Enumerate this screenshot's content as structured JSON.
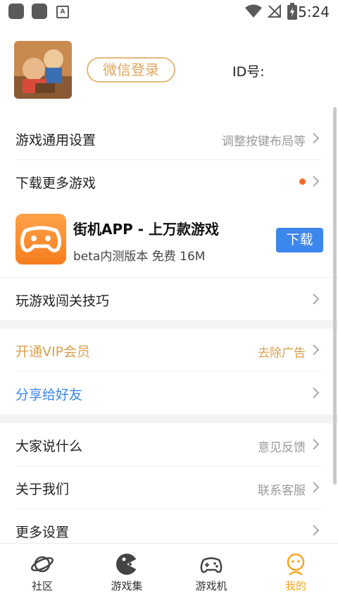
{
  "status_bar": {
    "time": "5:24",
    "badge_letter": "A"
  },
  "profile": {
    "login_button": "微信登录",
    "id_label": "ID号:"
  },
  "settings_rows": [
    {
      "label": "游戏通用设置",
      "hint": "调整按键布局等"
    },
    {
      "label": "下载更多游戏",
      "hint": ""
    }
  ],
  "app_promo": {
    "title": "街机APP - 上万款游戏",
    "subtitle": "beta内测版本 免费 16M",
    "download_label": "下载"
  },
  "tips_row": {
    "label": "玩游戏闯关技巧"
  },
  "vip_row": {
    "label": "开通VIP会员",
    "hint": "去除广告",
    "color": "#d9a04f"
  },
  "share_row": {
    "label": "分享给好友",
    "color": "#3b87ec"
  },
  "more_rows": [
    {
      "label": "大家说什么",
      "hint": "意见反馈"
    },
    {
      "label": "关于我们",
      "hint": "联系客服"
    },
    {
      "label": "更多设置",
      "hint": ""
    }
  ],
  "tabs": [
    {
      "label": "社区",
      "icon": "planet-icon",
      "active": false
    },
    {
      "label": "游戏集",
      "icon": "pacman-icon",
      "active": false
    },
    {
      "label": "游戏机",
      "icon": "gamepad-icon",
      "active": false
    },
    {
      "label": "我的",
      "icon": "profile-icon",
      "active": true
    }
  ],
  "colors": {
    "accent": "#f5a623",
    "download": "#3b87ec",
    "dot": "#f26b2a"
  }
}
